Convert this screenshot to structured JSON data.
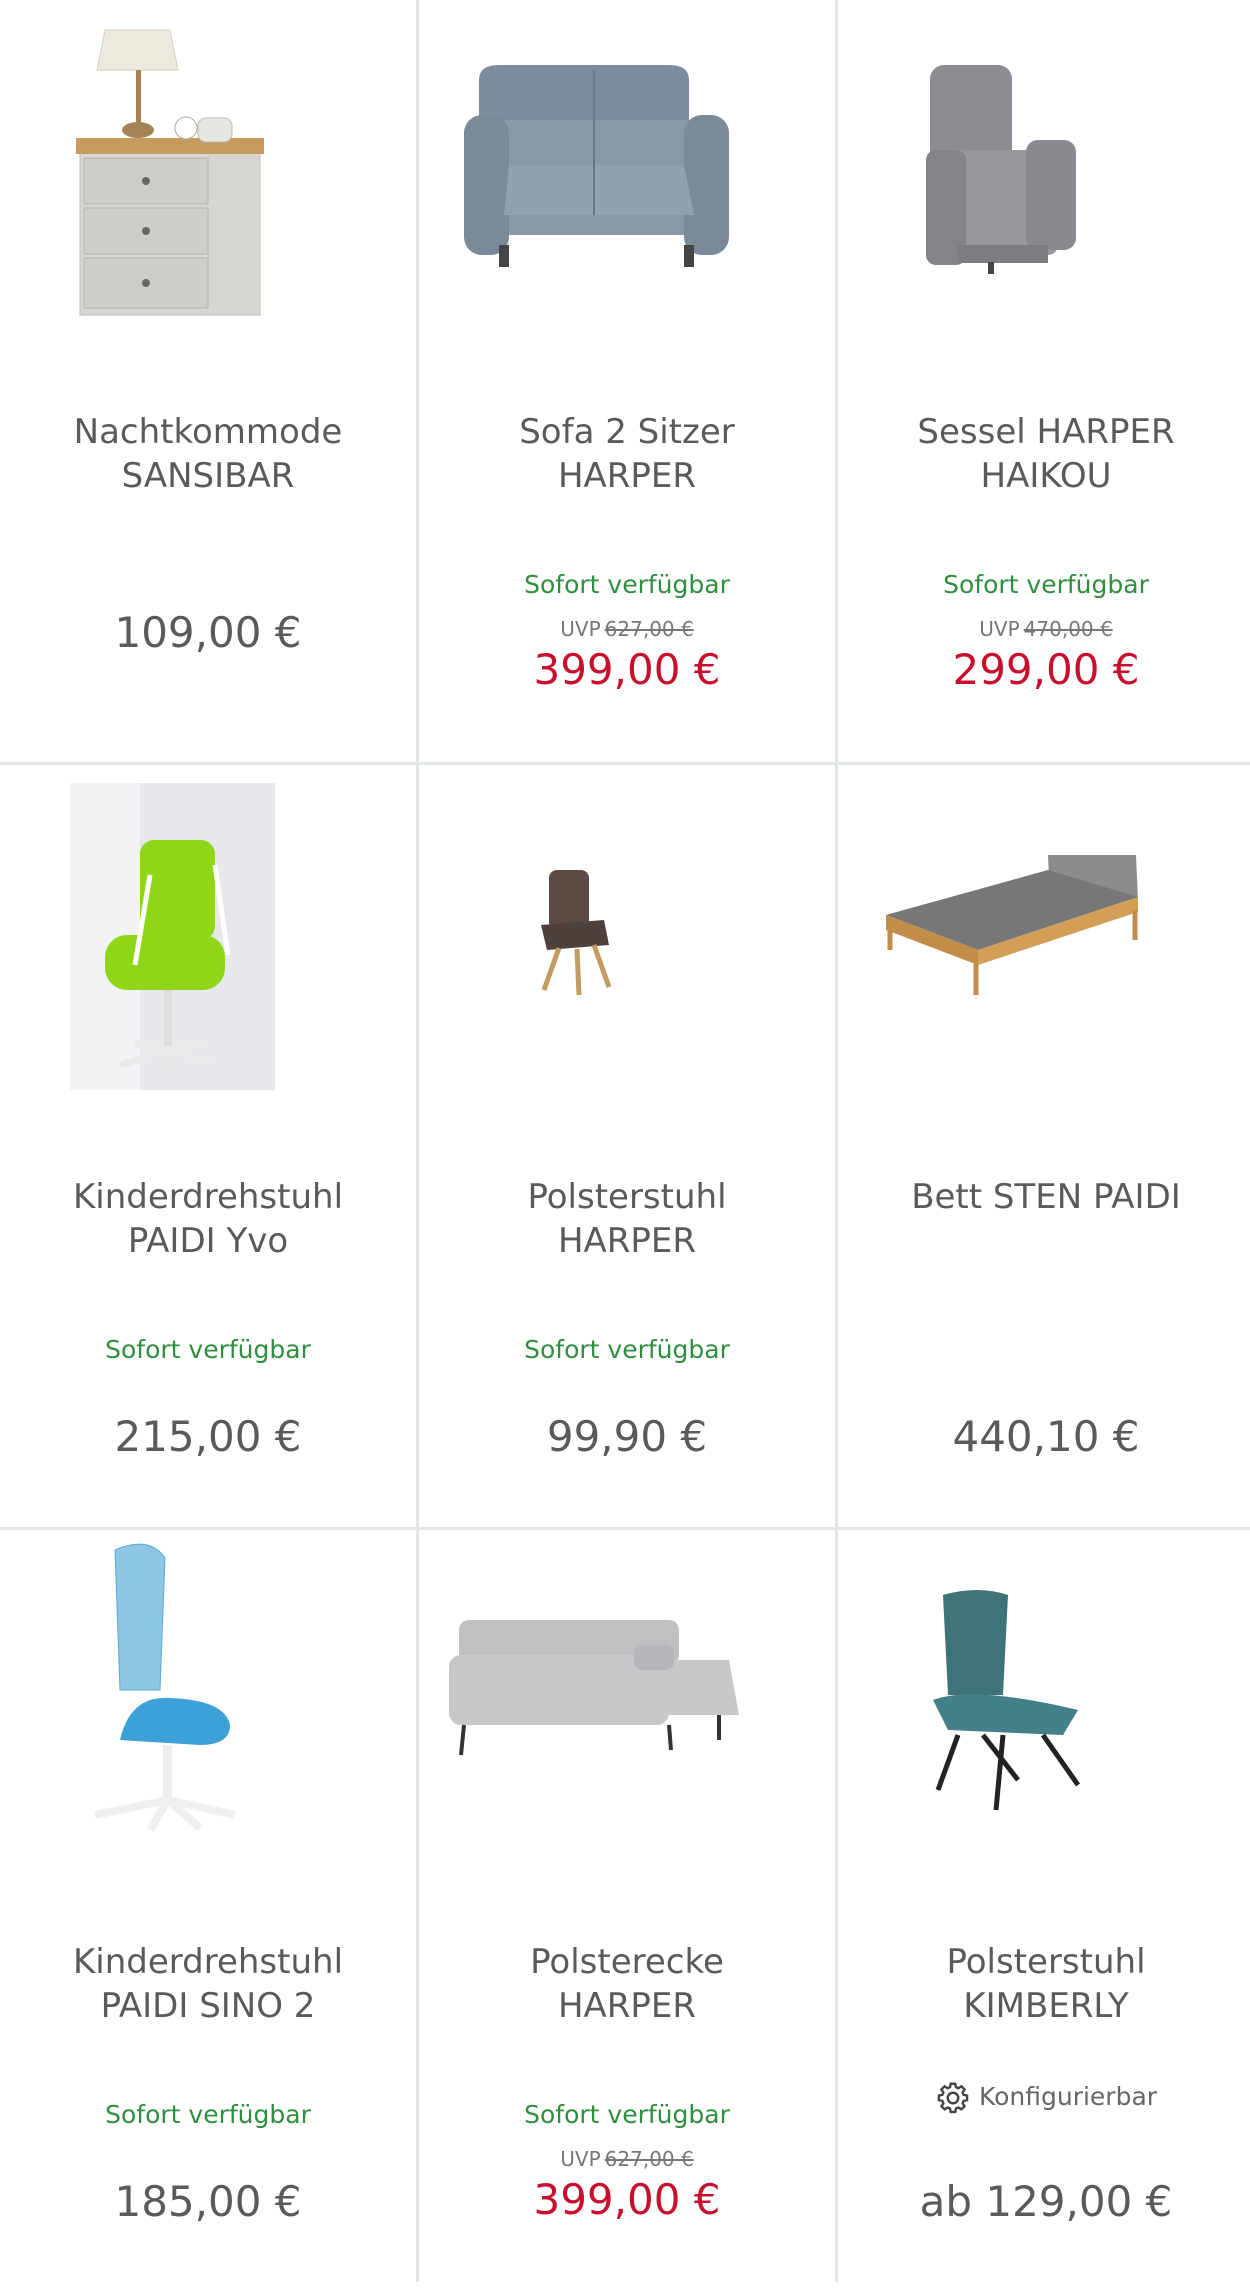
{
  "products": [
    {
      "name_line1": "Nachtkommode",
      "name_line2": "SANSIBAR",
      "availability": "",
      "uvp_label": "",
      "uvp_price": "",
      "price": "109,00 €",
      "sale": false,
      "configurable": "",
      "image": "nightstand-with-lamp"
    },
    {
      "name_line1": "Sofa 2 Sitzer",
      "name_line2": "HARPER",
      "availability": "Sofort verfügbar",
      "uvp_label": "UVP",
      "uvp_price": "627,00 €",
      "price": "399,00 €",
      "sale": true,
      "configurable": "",
      "image": "grey-blue-recliner-sofa"
    },
    {
      "name_line1": "Sessel HARPER",
      "name_line2": "HAIKOU",
      "availability": "Sofort verfügbar",
      "uvp_label": "UVP",
      "uvp_price": "470,00 €",
      "price": "299,00 €",
      "sale": true,
      "configurable": "",
      "image": "grey-recliner-armchair"
    },
    {
      "name_line1": "Kinderdrehstuhl",
      "name_line2": "PAIDI Yvo",
      "availability": "Sofort verfügbar",
      "uvp_label": "",
      "uvp_price": "",
      "price": "215,00 €",
      "sale": false,
      "configurable": "",
      "image": "green-kids-desk-chair"
    },
    {
      "name_line1": "Polsterstuhl",
      "name_line2": "HARPER",
      "availability": "Sofort verfügbar",
      "uvp_label": "",
      "uvp_price": "",
      "price": "99,90 €",
      "sale": false,
      "configurable": "",
      "image": "brown-dining-chair"
    },
    {
      "name_line1": "Bett STEN PAIDI",
      "name_line2": "",
      "availability": "",
      "uvp_label": "",
      "uvp_price": "",
      "price": "440,10 €",
      "sale": false,
      "configurable": "",
      "image": "wooden-bed-grey-mattress"
    },
    {
      "name_line1": "Kinderdrehstuhl",
      "name_line2": "PAIDI SINO 2",
      "availability": "Sofort verfügbar",
      "uvp_label": "",
      "uvp_price": "",
      "price": "185,00 €",
      "sale": false,
      "configurable": "",
      "image": "blue-mesh-kids-chair"
    },
    {
      "name_line1": "Polsterecke",
      "name_line2": "HARPER",
      "availability": "Sofort verfügbar",
      "uvp_label": "UVP",
      "uvp_price": "627,00 €",
      "price": "399,00 €",
      "sale": true,
      "configurable": "",
      "image": "grey-corner-sofa"
    },
    {
      "name_line1": "Polsterstuhl",
      "name_line2": "KIMBERLY",
      "availability": "",
      "uvp_label": "",
      "uvp_price": "",
      "price": "ab 129,00 €",
      "sale": false,
      "configurable": "Konfigurierbar",
      "image": "teal-dining-chair"
    }
  ],
  "colors": {
    "available": "#2f8f3f",
    "sale_price": "#c8102e",
    "regular_price": "#5a5a5a",
    "divider": "#e3e6e9"
  },
  "icons": {
    "configurable": "gear-icon"
  }
}
